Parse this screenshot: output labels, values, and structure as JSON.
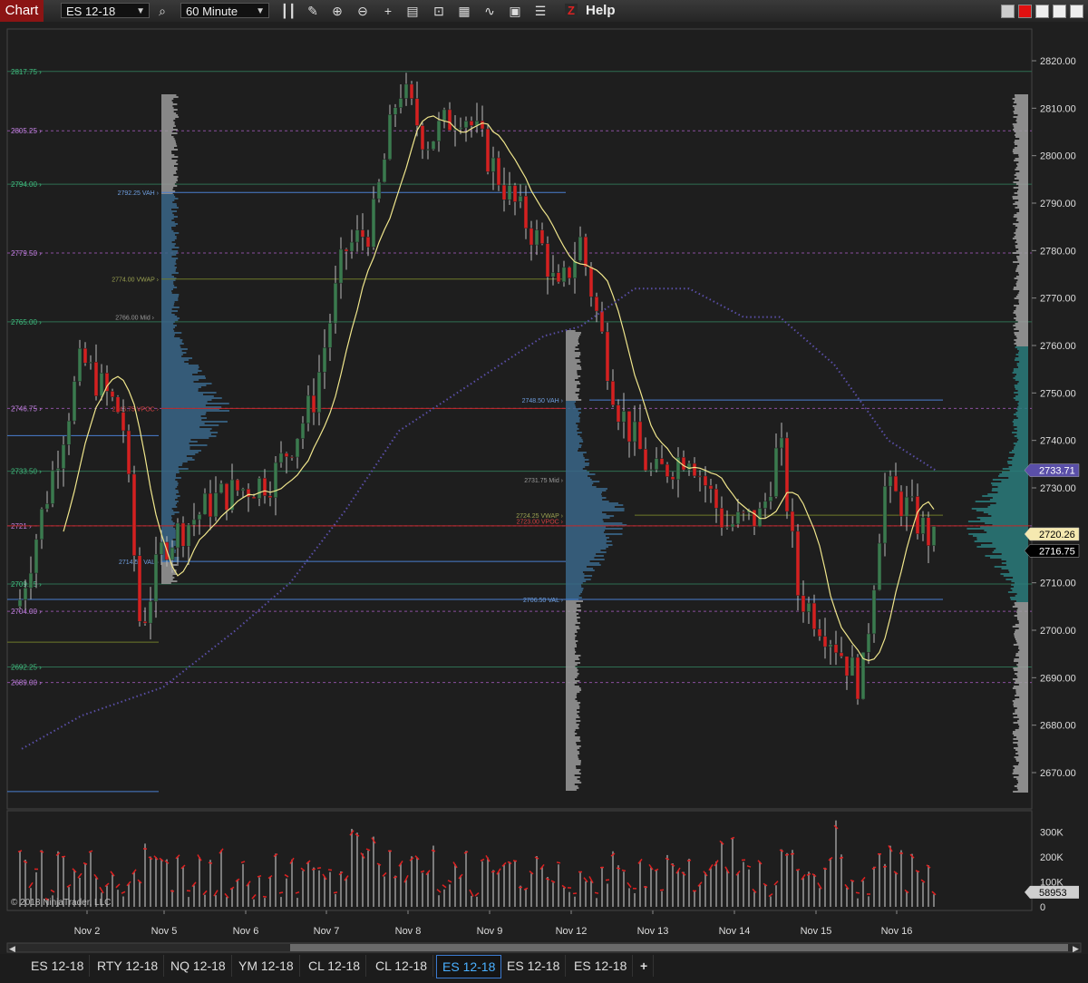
{
  "toolbar": {
    "app_tab": "Chart",
    "instrument": "ES 12-18",
    "interval": "60 Minute",
    "help": "Help",
    "icons": [
      "search-icon",
      "bar-style-icon",
      "draw-icon",
      "zoom-in-icon",
      "zoom-out-icon",
      "crosshair-icon",
      "properties-icon",
      "data-box-icon",
      "indicators-icon",
      "strategies-icon",
      "templates-icon",
      "chart-trader-icon"
    ]
  },
  "chart": {
    "copyright": "© 2018 NinjaTrader, LLC",
    "price_axis_labels": [
      "2820.00",
      "2810.00",
      "2800.00",
      "2790.00",
      "2780.00",
      "2770.00",
      "2760.00",
      "2750.00",
      "2740.00",
      "2730.00",
      "2720.00",
      "2710.00",
      "2700.00",
      "2690.00",
      "2680.00",
      "2670.00"
    ],
    "price_markers": [
      {
        "value": "2733.71",
        "color": "#5a4fa8",
        "text_color": "#ffffff"
      },
      {
        "value": "2720.26",
        "color": "#f5e9b0",
        "text_color": "#000000"
      },
      {
        "value": "2716.75",
        "color": "#000000",
        "text_color": "#ffffff"
      }
    ],
    "volume_axis_labels": [
      "300K",
      "200K",
      "100K",
      "0"
    ],
    "volume_marker": "58953",
    "date_labels": [
      "Nov 2",
      "Nov 5",
      "Nov 6",
      "Nov 7",
      "Nov 8",
      "Nov 9",
      "Nov 12",
      "Nov 13",
      "Nov 14",
      "Nov 15",
      "Nov 16"
    ],
    "level_labels": [
      {
        "text": "2817.75",
        "color": "#3fbf7f"
      },
      {
        "text": "2805.25",
        "color": "#c080e0"
      },
      {
        "text": "2794.00",
        "color": "#3fbf7f"
      },
      {
        "text": "2779.50",
        "color": "#c080e0"
      },
      {
        "text": "2765.00",
        "color": "#3fbf7f"
      },
      {
        "text": "2746.75",
        "color": "#c080e0"
      },
      {
        "text": "2733.50",
        "color": "#3fbf7f"
      },
      {
        "text": "2721",
        "color": "#c080e0"
      },
      {
        "text": "2709.75",
        "color": "#3fbf7f"
      },
      {
        "text": "2704.00",
        "color": "#c080e0"
      },
      {
        "text": "2692.25",
        "color": "#3fbf7f"
      },
      {
        "text": "2689.00",
        "color": "#c080e0"
      }
    ],
    "profile_labels": [
      {
        "text": "2792.25 VAH",
        "color": "#6f9fe0"
      },
      {
        "text": "2774.00 VWAP",
        "color": "#9aa050"
      },
      {
        "text": "2766.00 Mid",
        "color": "#999999"
      },
      {
        "text": "2746.75 VPOC",
        "color": "#d04040"
      },
      {
        "text": "2714.50 VAL",
        "color": "#6f9fe0"
      },
      {
        "text": "2748.50 VAH",
        "color": "#6f9fe0"
      },
      {
        "text": "2731.75 Mid",
        "color": "#999999"
      },
      {
        "text": "2724.25 VWAP",
        "color": "#9aa050"
      },
      {
        "text": "2723.00 VPOC",
        "color": "#d04040"
      },
      {
        "text": "2706.50 VAL",
        "color": "#6f9fe0"
      }
    ],
    "colors": {
      "up": "#3a7a4e",
      "down": "#d42020",
      "sma": "#f0e68c",
      "vwap": "#5a4fa8",
      "grid": "#2e2e2e"
    }
  },
  "tabs": [
    "ES 12-18",
    "RTY 12-18",
    "NQ 12-18",
    "YM 12-18",
    "CL 12-18",
    "CL 12-18",
    "ES 12-18",
    "ES 12-18",
    "ES 12-18"
  ],
  "active_tab": 6,
  "add_tab": "+"
}
